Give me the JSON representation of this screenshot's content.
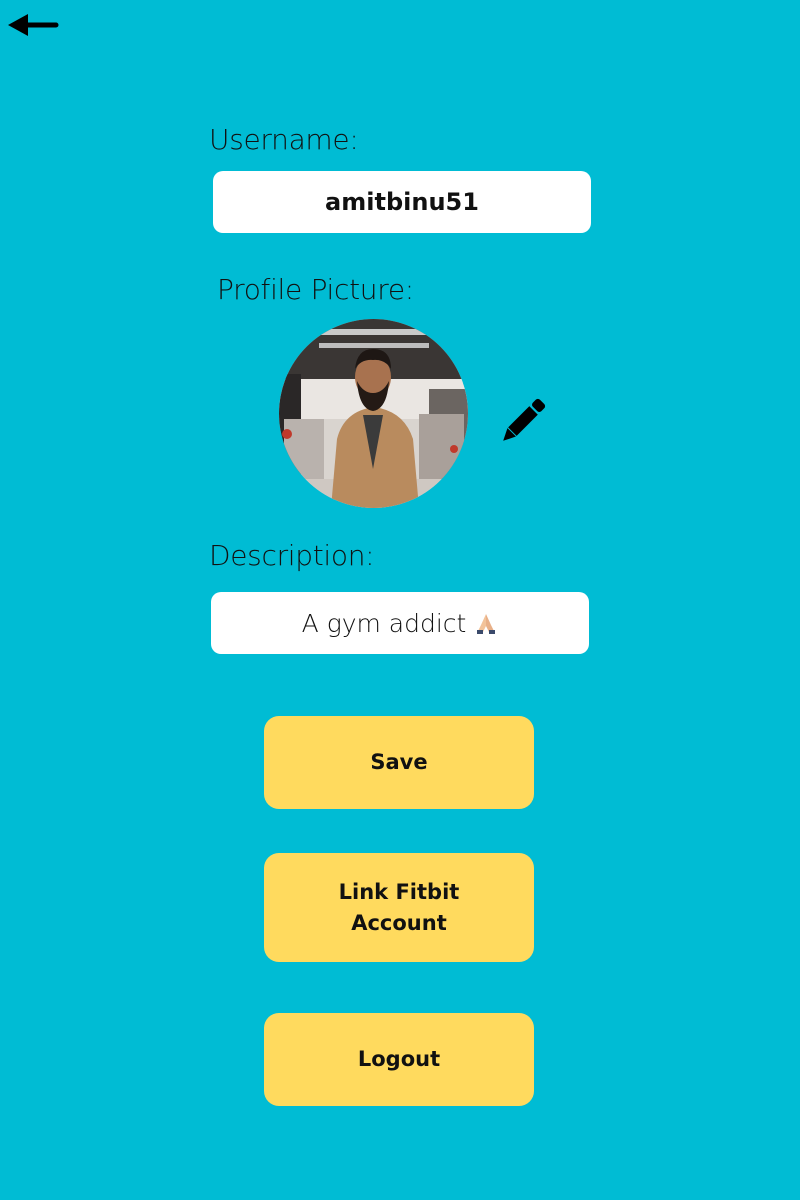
{
  "header": {
    "back_icon": "arrow-left-icon"
  },
  "username": {
    "label": "Username:",
    "value": "amitbinu51"
  },
  "profile_picture": {
    "label": "Profile Picture:",
    "edit_icon": "pencil-icon"
  },
  "description": {
    "label": "Description:",
    "value": "A gym addict",
    "emoji_icon": "folded-hands-emoji-icon"
  },
  "buttons": {
    "save": "Save",
    "link_fitbit": "Link Fitbit Account",
    "logout": "Logout"
  },
  "colors": {
    "background": "#00BCD4",
    "button": "#FFDA5E",
    "field": "#FFFFFF"
  }
}
